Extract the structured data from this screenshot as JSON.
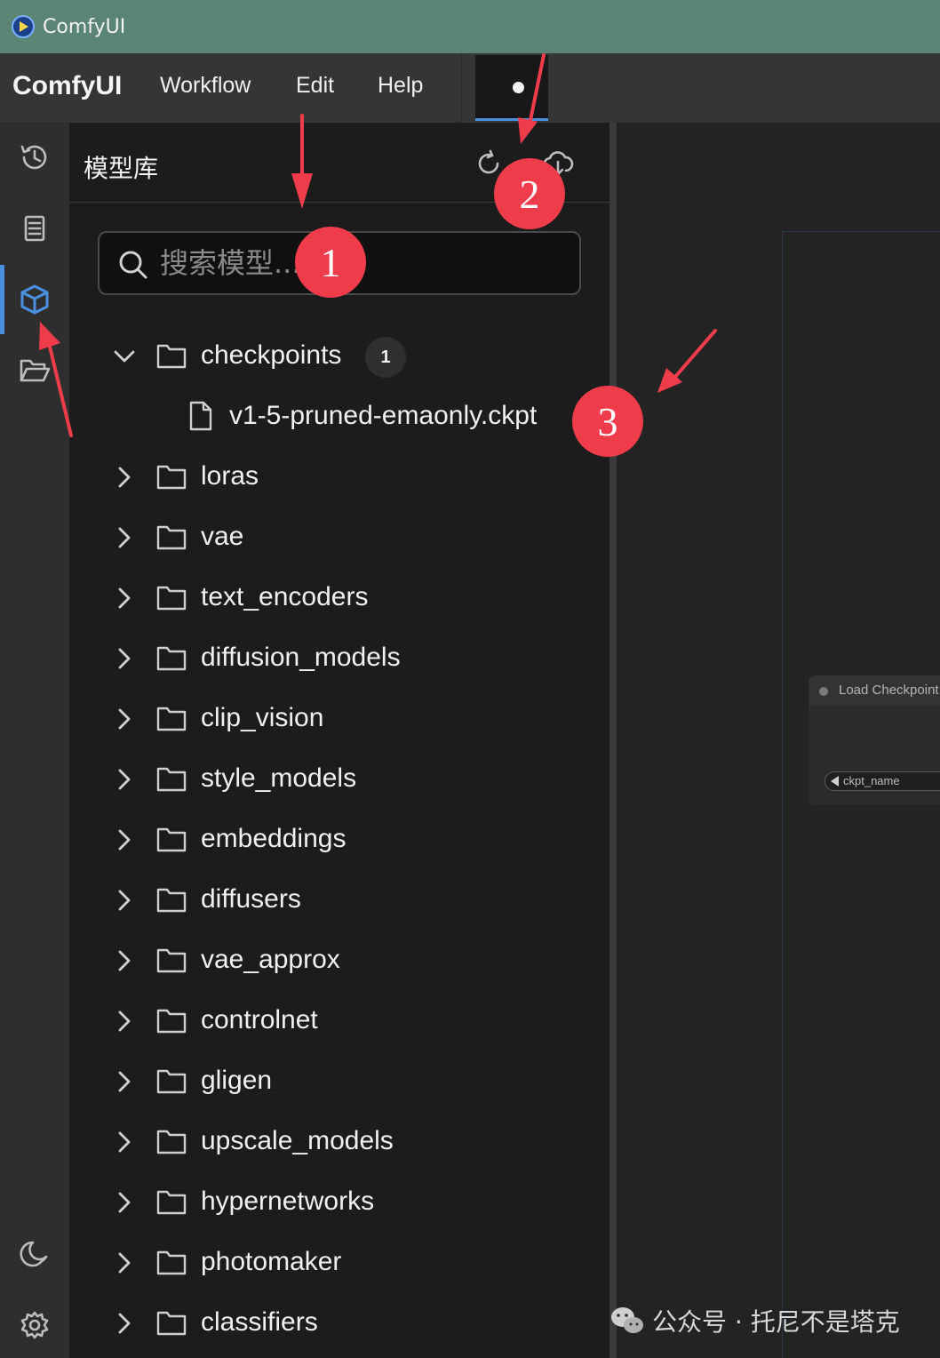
{
  "window": {
    "title": "ComfyUI"
  },
  "menubar": {
    "brand": "ComfyUI",
    "items": [
      "Workflow",
      "Edit",
      "Help"
    ]
  },
  "rail": {
    "icons": [
      "history-icon",
      "queue-icon",
      "model-library-icon",
      "workflows-icon",
      "theme-icon",
      "settings-icon"
    ],
    "active": "model-library-icon",
    "accent_color": "#4b8fe0"
  },
  "panel": {
    "title": "模型库",
    "search": {
      "placeholder": "搜索模型...",
      "value": ""
    },
    "tree": {
      "expanded_folder": {
        "label": "checkpoints",
        "count": "1"
      },
      "files": [
        "v1-5-pruned-emaonly.ckpt"
      ],
      "collapsed_folders": [
        "loras",
        "vae",
        "text_encoders",
        "diffusion_models",
        "clip_vision",
        "style_models",
        "embeddings",
        "diffusers",
        "vae_approx",
        "controlnet",
        "gligen",
        "upscale_models",
        "hypernetworks",
        "photomaker",
        "classifiers"
      ]
    }
  },
  "canvas": {
    "node": {
      "title": "Load Checkpoint",
      "widget_label": "ckpt_name"
    }
  },
  "annotations": {
    "markers": [
      "1",
      "2",
      "3"
    ],
    "color": "#ef3c4b"
  },
  "watermark": {
    "text": "公众号 · 托尼不是塔克"
  }
}
